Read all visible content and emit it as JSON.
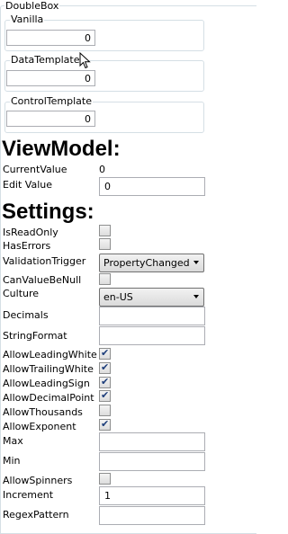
{
  "outer": {
    "title": "DoubleBox"
  },
  "groups": [
    {
      "title": "Vanilla",
      "value": "0"
    },
    {
      "title": "DataTemplate",
      "value": "0"
    },
    {
      "title": "ControlTemplate",
      "value": "0"
    }
  ],
  "viewmodel": {
    "heading": "ViewModel:",
    "current_value_label": "CurrentValue",
    "current_value": "0",
    "edit_value_label": "Edit Value",
    "edit_value": "0"
  },
  "settings": {
    "heading": "Settings:",
    "is_read_only_label": "IsReadOnly",
    "is_read_only": false,
    "has_errors_label": "HasErrors",
    "has_errors": false,
    "validation_trigger_label": "ValidationTrigger",
    "validation_trigger": "PropertyChanged",
    "can_value_be_null_label": "CanValueBeNull",
    "can_value_be_null": false,
    "culture_label": "Culture",
    "culture": "en-US",
    "decimals_label": "Decimals",
    "decimals": "",
    "string_format_label": "StringFormat",
    "string_format": "",
    "allow_leading_white_label": "AllowLeadingWhite",
    "allow_leading_white": true,
    "allow_trailing_white_label": "AllowTrailingWhite",
    "allow_trailing_white": true,
    "allow_leading_sign_label": "AllowLeadingSign",
    "allow_leading_sign": true,
    "allow_decimal_point_label": "AllowDecimalPoint",
    "allow_decimal_point": true,
    "allow_thousands_label": "AllowThousands",
    "allow_thousands": false,
    "allow_exponent_label": "AllowExponent",
    "allow_exponent": true,
    "max_label": "Max",
    "max": "",
    "min_label": "Min",
    "min": "",
    "allow_spinners_label": "AllowSpinners",
    "allow_spinners": false,
    "increment_label": "Increment",
    "increment": "1",
    "regex_pattern_label": "RegexPattern",
    "regex_pattern": ""
  },
  "icons": {
    "checkmark": "✔",
    "cursor": "mouse-pointer-icon"
  }
}
